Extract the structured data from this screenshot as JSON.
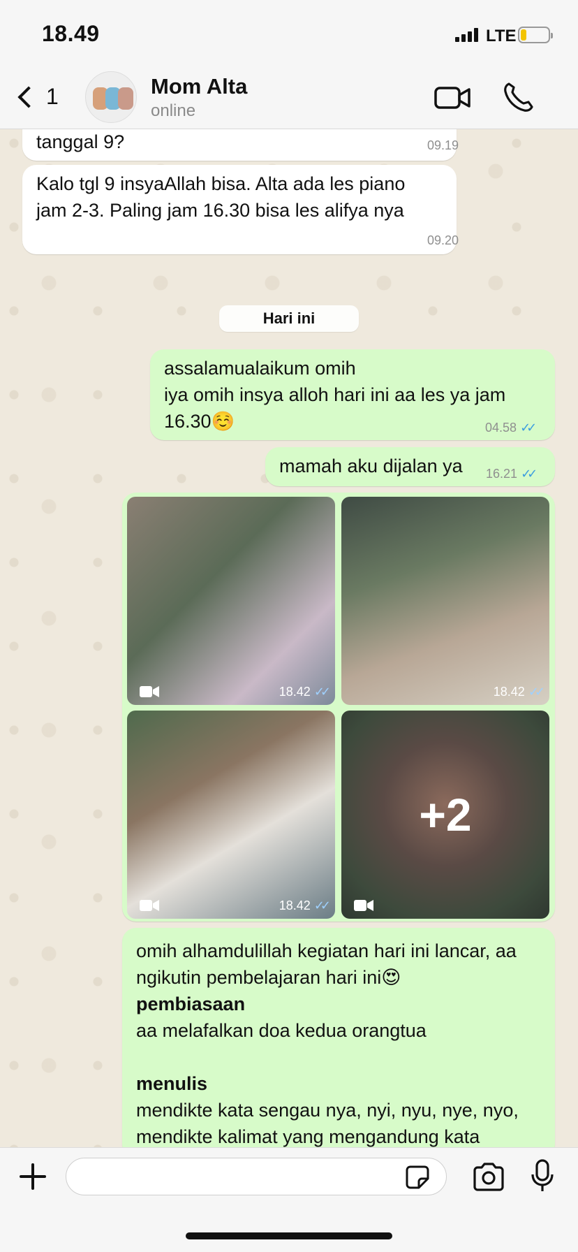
{
  "status_bar": {
    "time": "18.49",
    "network": "LTE"
  },
  "header": {
    "back_count": "1",
    "contact_name": "Mom Alta",
    "contact_status": "online",
    "icons": {
      "back": "chevron-left-icon",
      "video": "video-call-icon",
      "voice": "phone-icon"
    }
  },
  "messages": [
    {
      "direction": "incoming",
      "text": "tanggal 9?",
      "time": "09.19"
    },
    {
      "direction": "incoming",
      "text": "Kalo tgl 9 insyaAllah bisa. Alta ada les piano\njam 2-3. Paling jam 16.30 bisa les alifya nya",
      "time": "09.20"
    },
    {
      "direction": "outgoing",
      "text": "assalamualaikum omih\niya omih insya alloh hari ini aa les ya jam\n16.30☺️",
      "time": "04.58",
      "read": true
    },
    {
      "direction": "outgoing",
      "text": "mamah aku dijalan ya",
      "time": "16.21",
      "read": true
    }
  ],
  "date_divider": "Hari ini",
  "media_grid": {
    "items": [
      {
        "type": "video",
        "time": "18.42",
        "read": true
      },
      {
        "type": "video",
        "time": "18.42",
        "read": true
      },
      {
        "type": "video",
        "time": "18.42",
        "read": true
      },
      {
        "type": "video",
        "more_count": "+2"
      }
    ]
  },
  "report_message": {
    "intro": "omih alhamdulillah kegiatan hari ini lancar, aa\nngikutin pembelajaran hari ini😍",
    "section1_title": "pembiasaan",
    "section1_body": "aa melafalkan doa kedua orangtua",
    "section2_title": "menulis",
    "section2_body": "mendikte kata sengau nya, nyi, nyu, nye, nyo,\nmendikte kalimat yang mengandung kata"
  },
  "input_bar": {
    "placeholder": ""
  },
  "colors": {
    "outgoing_bubble": "#d7fbc9",
    "incoming_bubble": "#ffffff",
    "read_ticks": "#3b9de0"
  }
}
